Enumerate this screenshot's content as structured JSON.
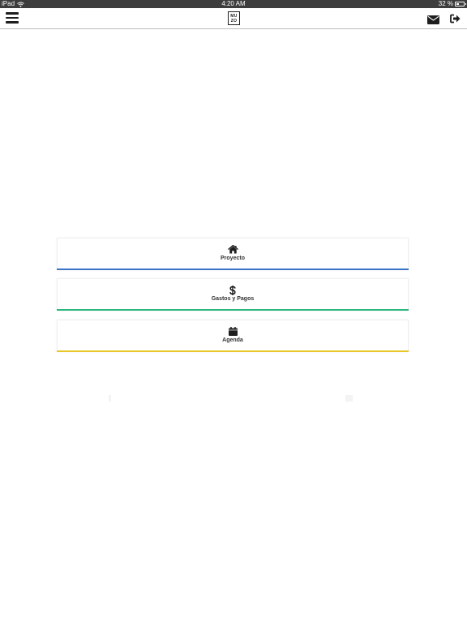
{
  "status_bar": {
    "device": "iPad",
    "time": "4:20 AM",
    "battery_percent": "32 %",
    "battery_level": 0.32,
    "wifi_icon": "wifi-icon",
    "battery_icon": "battery-icon"
  },
  "header": {
    "menu_icon": "hamburger-menu-icon",
    "logo": {
      "line1": "MU",
      "line2": "ZO"
    },
    "mail_icon": "envelope-icon",
    "signout_icon": "sign-out-icon"
  },
  "cards": [
    {
      "label": "Proyecto",
      "icon": "home-icon",
      "accent": "#3b73c7"
    },
    {
      "label": "Gastos y Pagos",
      "icon": "dollar-icon",
      "accent": "#2db67c"
    },
    {
      "label": "Agenda",
      "icon": "calendar-icon",
      "accent": "#e8c72a"
    }
  ],
  "colors": {
    "status_bar_bg": "#3d3d3d",
    "text_primary": "#1e1e1e",
    "card_label": "#333333"
  }
}
